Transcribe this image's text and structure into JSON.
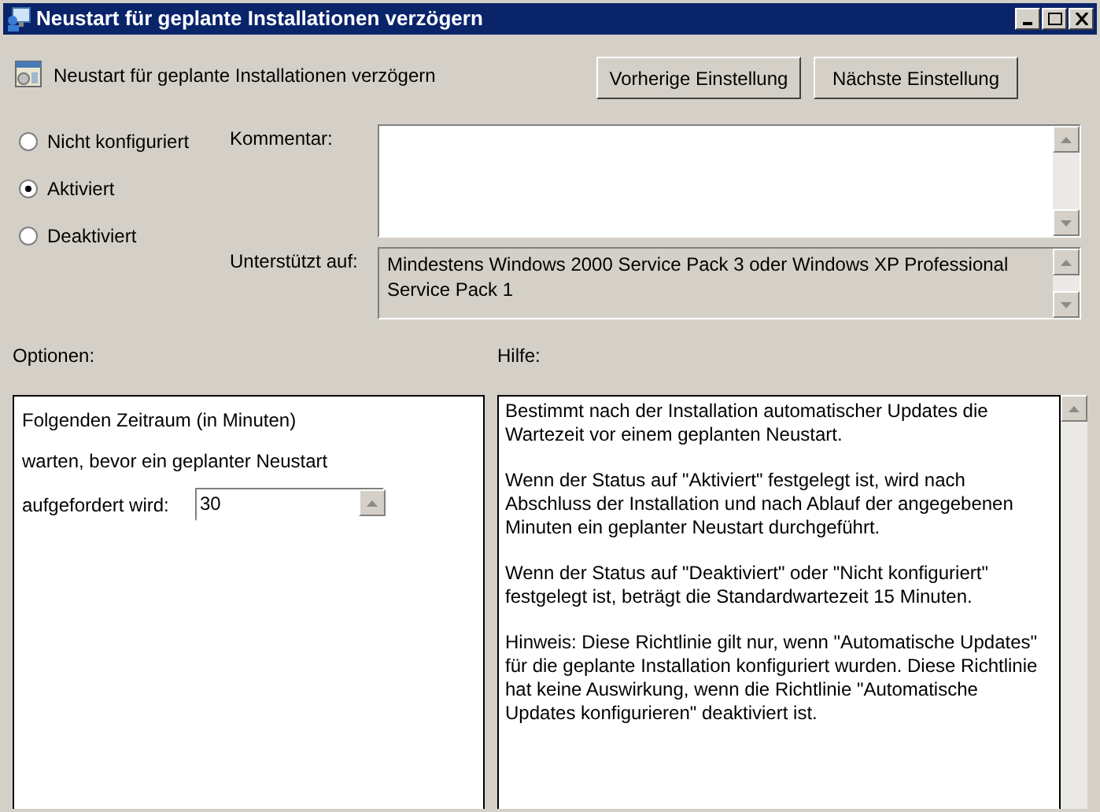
{
  "window": {
    "title": "Neustart für geplante Installationen verzögern"
  },
  "header": {
    "title": "Neustart für geplante Installationen verzögern",
    "buttons": [
      "Vorherige Einstellung",
      "Nächste Einstellung"
    ]
  },
  "state_options": [
    {
      "label": "Nicht konfiguriert",
      "selected": false
    },
    {
      "label": "Aktiviert",
      "selected": true
    },
    {
      "label": "Deaktiviert",
      "selected": false
    }
  ],
  "comment": {
    "label": "Kommentar:"
  },
  "supported": {
    "label": "Unterstützt auf:",
    "value": "Mindestens Windows 2000 Service Pack 3 oder Windows XP Professional Service Pack 1"
  },
  "options": {
    "label": "Optionen:",
    "lines": [
      "Folgenden Zeitraum (in Minuten)",
      "warten, bevor ein geplanter Neustart"
    ],
    "field_label": "aufgefordert wird:",
    "value": "30"
  },
  "help": {
    "label": "Hilfe:",
    "paragraphs": [
      "Bestimmt nach der Installation automatischer Updates die Wartezeit vor einem geplanten Neustart.",
      "Wenn der Status auf \"Aktiviert\" festgelegt ist, wird nach Abschluss der Installation und nach Ablauf der angegebenen Minuten ein geplanter Neustart durchgeführt.",
      "Wenn der Status auf \"Deaktiviert\" oder \"Nicht konfiguriert\" festgelegt ist, beträgt die Standardwartezeit 15 Minuten.",
      "Hinweis: Diese Richtlinie gilt nur, wenn \"Automatische Updates\" für die geplante Installation konfiguriert wurden. Diese Richtlinie hat keine Auswirkung, wenn die Richtlinie \"Automatische Updates konfigurieren\" deaktiviert ist."
    ]
  }
}
